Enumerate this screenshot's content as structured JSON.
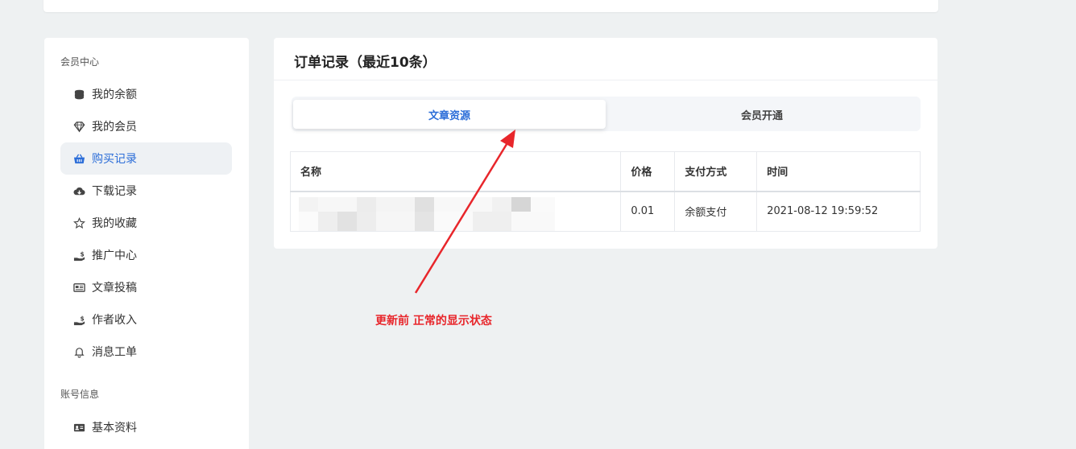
{
  "sidebar": {
    "section_member": "会员中心",
    "items": [
      {
        "label": "我的余额",
        "icon": "coins-icon",
        "active": false
      },
      {
        "label": "我的会员",
        "icon": "diamond-icon",
        "active": false
      },
      {
        "label": "购买记录",
        "icon": "basket-icon",
        "active": true
      },
      {
        "label": "下载记录",
        "icon": "cloud-download-icon",
        "active": false
      },
      {
        "label": "我的收藏",
        "icon": "star-icon",
        "active": false
      },
      {
        "label": "推广中心",
        "icon": "hand-dollar-icon",
        "active": false
      },
      {
        "label": "文章投稿",
        "icon": "newspaper-icon",
        "active": false
      },
      {
        "label": "作者收入",
        "icon": "hand-dollar-icon",
        "active": false
      },
      {
        "label": "消息工单",
        "icon": "bell-icon",
        "active": false
      }
    ],
    "section_account": "账号信息",
    "account_items": [
      {
        "label": "基本资料",
        "icon": "id-card-icon",
        "active": false
      }
    ]
  },
  "main": {
    "title": "订单记录（最近10条）",
    "tabs": [
      {
        "label": "文章资源",
        "active": true
      },
      {
        "label": "会员开通",
        "active": false
      }
    ],
    "table": {
      "headers": [
        "名称",
        "价格",
        "支付方式",
        "时间"
      ],
      "rows": [
        {
          "name": "",
          "price": "0.01",
          "payment": "余额支付",
          "time": "2021-08-12 19:59:52"
        }
      ]
    }
  },
  "annotation": {
    "text": "更新前 正常的显示状态",
    "color": "#e8262b"
  },
  "colors": {
    "accent": "#2b6dd8",
    "background": "#eef1f2"
  }
}
